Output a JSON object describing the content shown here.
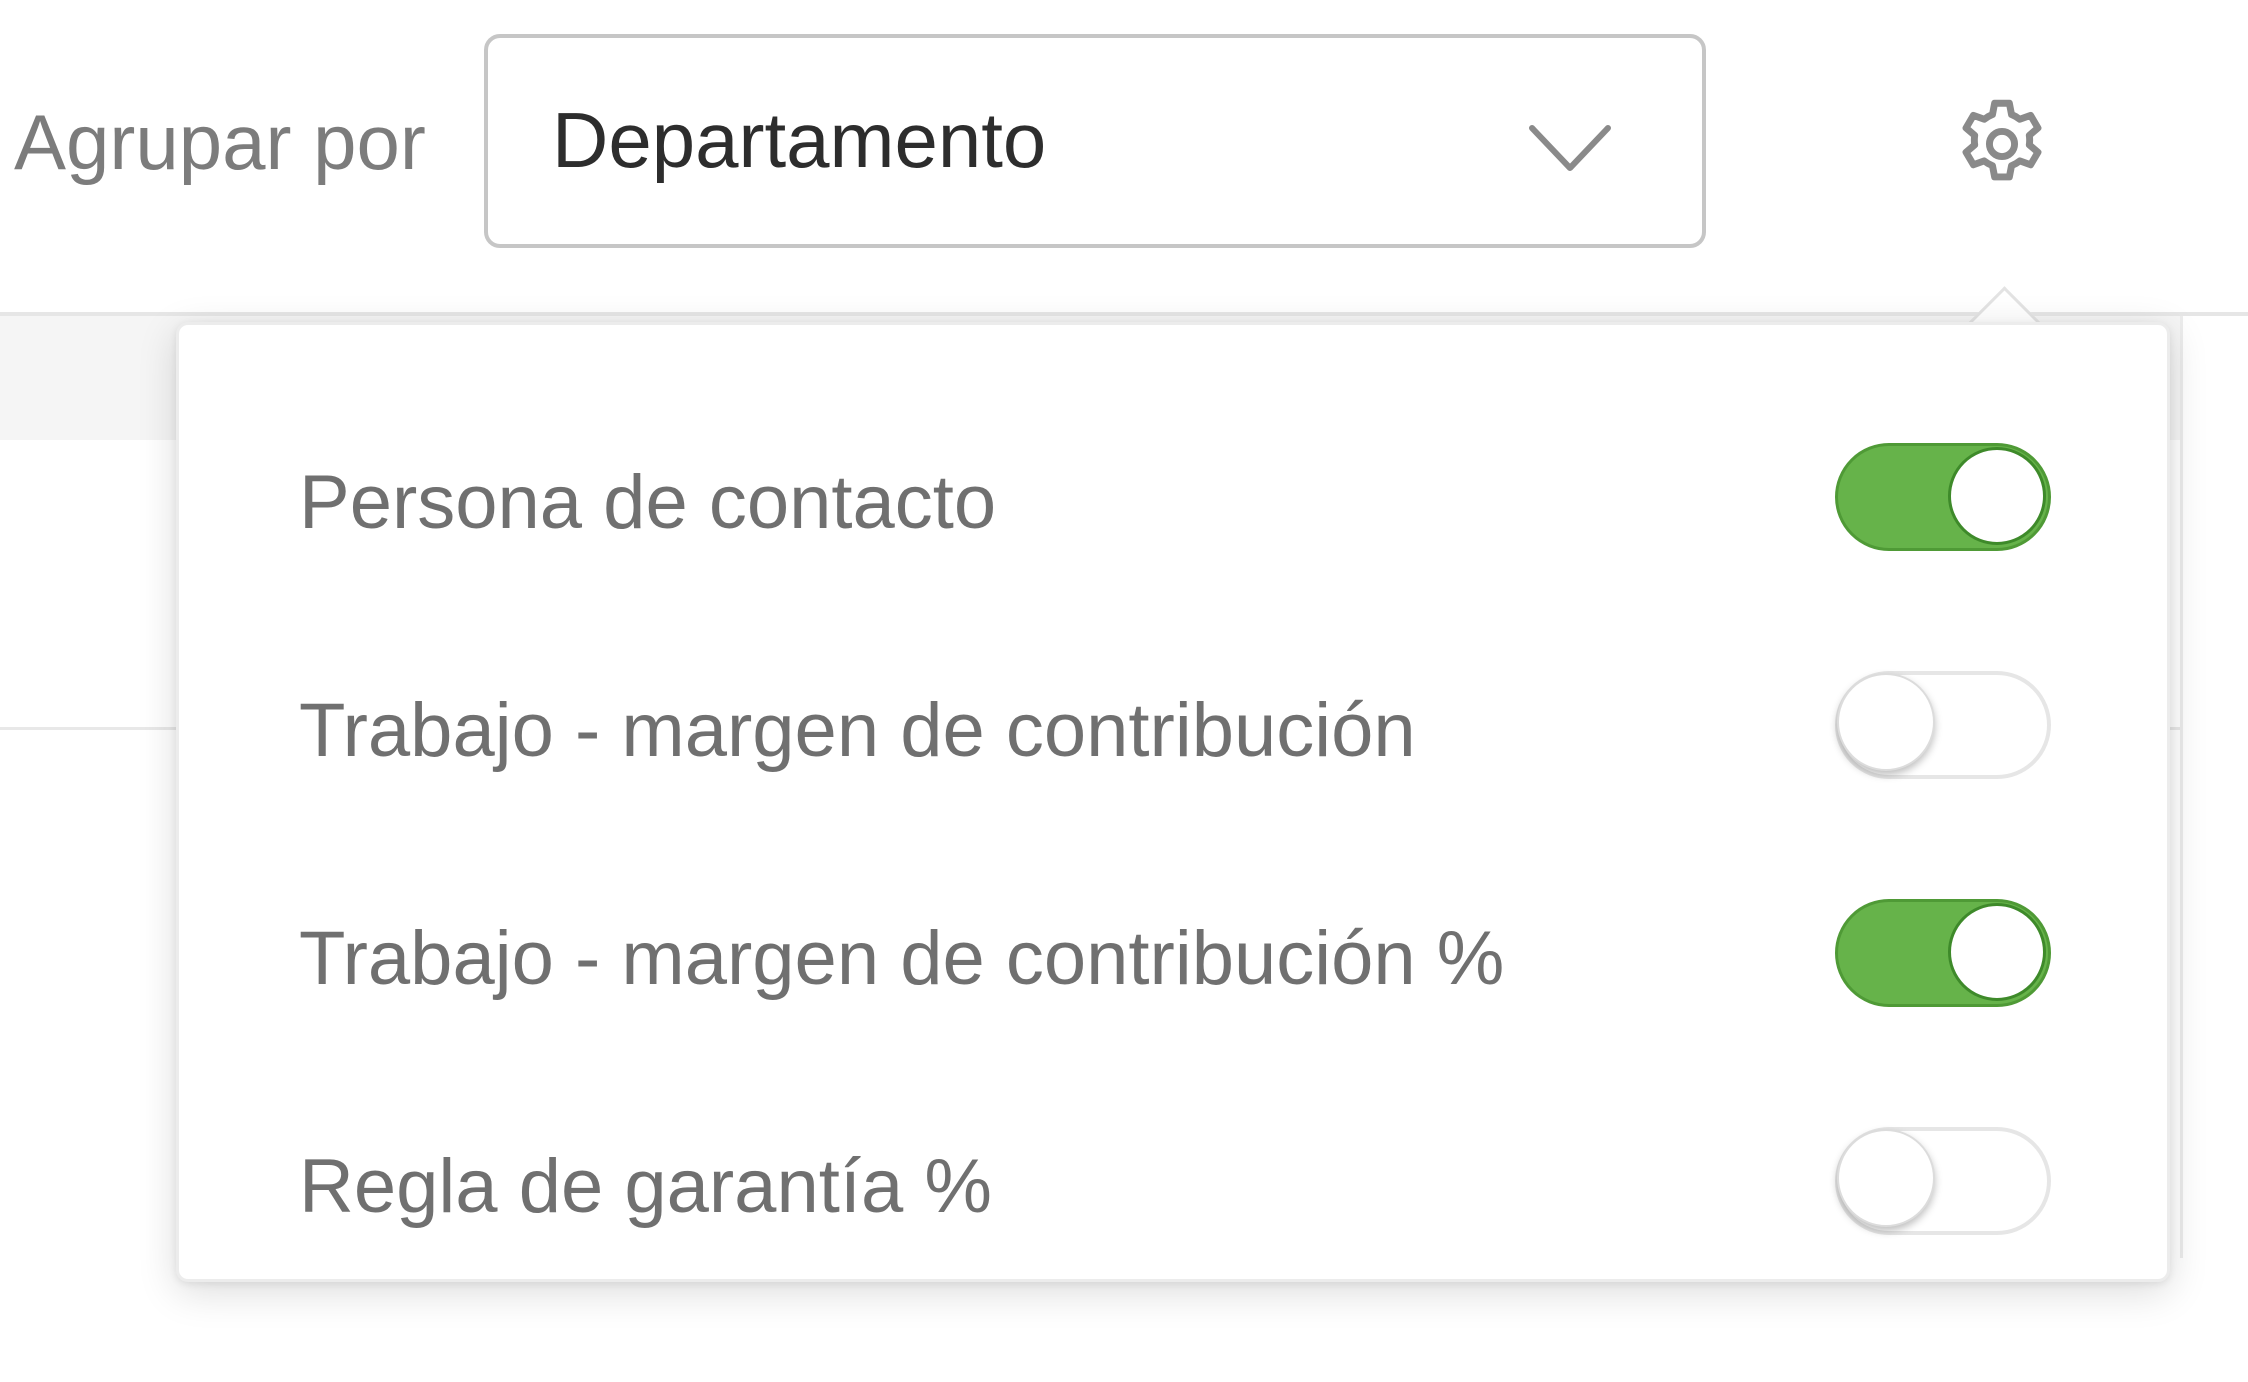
{
  "toolbar": {
    "group_by_label": "Agrupar por",
    "group_by_value": "Departamento",
    "chevron_icon": "chevron-down-icon",
    "settings_icon": "gear-icon"
  },
  "settings_popover": {
    "items": [
      {
        "label": "Persona de contacto",
        "enabled": true
      },
      {
        "label": "Trabajo - margen de contribución",
        "enabled": false
      },
      {
        "label": "Trabajo - margen de contribución %",
        "enabled": true
      },
      {
        "label": "Regla de garantía %",
        "enabled": false
      }
    ]
  },
  "colors": {
    "toggle_on": "#66b34a",
    "toggle_off": "#ffffff",
    "label_text": "#707070"
  }
}
